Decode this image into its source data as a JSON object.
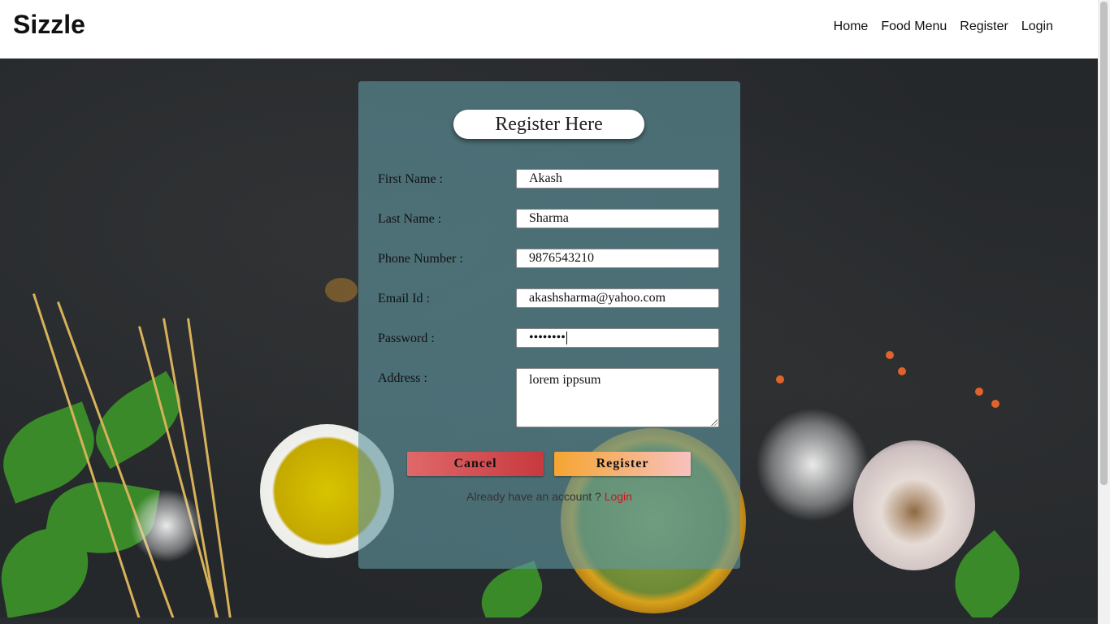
{
  "header": {
    "brand": "Sizzle",
    "nav": [
      "Home",
      "Food Menu",
      "Register",
      "Login"
    ]
  },
  "form": {
    "title": "Register Here",
    "fields": [
      {
        "label": "First Name :",
        "value": "Akash"
      },
      {
        "label": "Last Name :",
        "value": "Sharma"
      },
      {
        "label": "Phone Number :",
        "value": "9876543210"
      },
      {
        "label": "Email Id :",
        "value": "akashsharma@yahoo.com"
      },
      {
        "label": "Password :",
        "value": "••••••••"
      },
      {
        "label": "Address :",
        "value": "lorem ippsum"
      }
    ],
    "cancel_label": "Cancel",
    "register_label": "Register",
    "account_prompt": "Already have an account ?",
    "login_link": "Login"
  },
  "colors": {
    "card_bg": "#5f96a0",
    "cancel_button": "#d24f53",
    "register_button": "#f5a531",
    "login_link": "#c8161d"
  }
}
